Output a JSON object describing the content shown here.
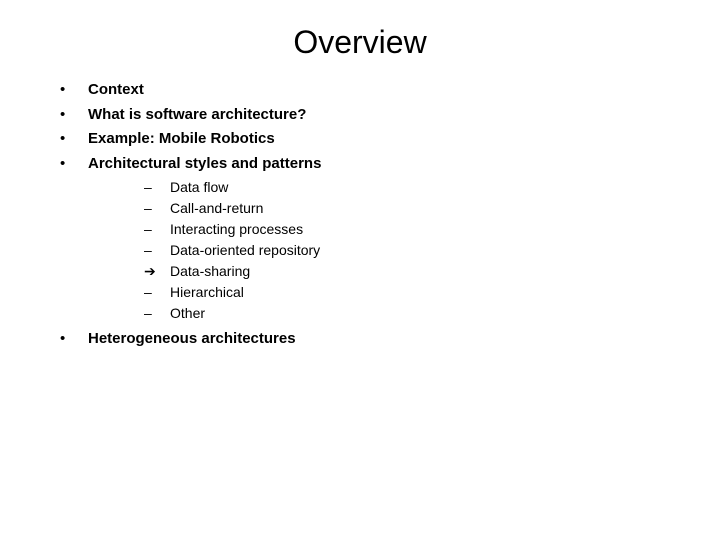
{
  "title": "Overview",
  "bullets": {
    "l1_marker": "•",
    "l2_marker_dash": "–",
    "l2_marker_arrow": "➔",
    "items": [
      {
        "text": "Context"
      },
      {
        "text": "What is software architecture?"
      },
      {
        "text": "Example: Mobile Robotics"
      },
      {
        "text": "Architectural styles and patterns",
        "sub": [
          {
            "marker": "dash",
            "text": "Data flow"
          },
          {
            "marker": "dash",
            "text": "Call-and-return"
          },
          {
            "marker": "dash",
            "text": "Interacting processes"
          },
          {
            "marker": "dash",
            "text": "Data-oriented repository"
          },
          {
            "marker": "arrow",
            "text": "Data-sharing"
          },
          {
            "marker": "dash",
            "text": "Hierarchical"
          },
          {
            "marker": "dash",
            "text": "Other"
          }
        ]
      },
      {
        "text": "Heterogeneous architectures"
      }
    ]
  }
}
